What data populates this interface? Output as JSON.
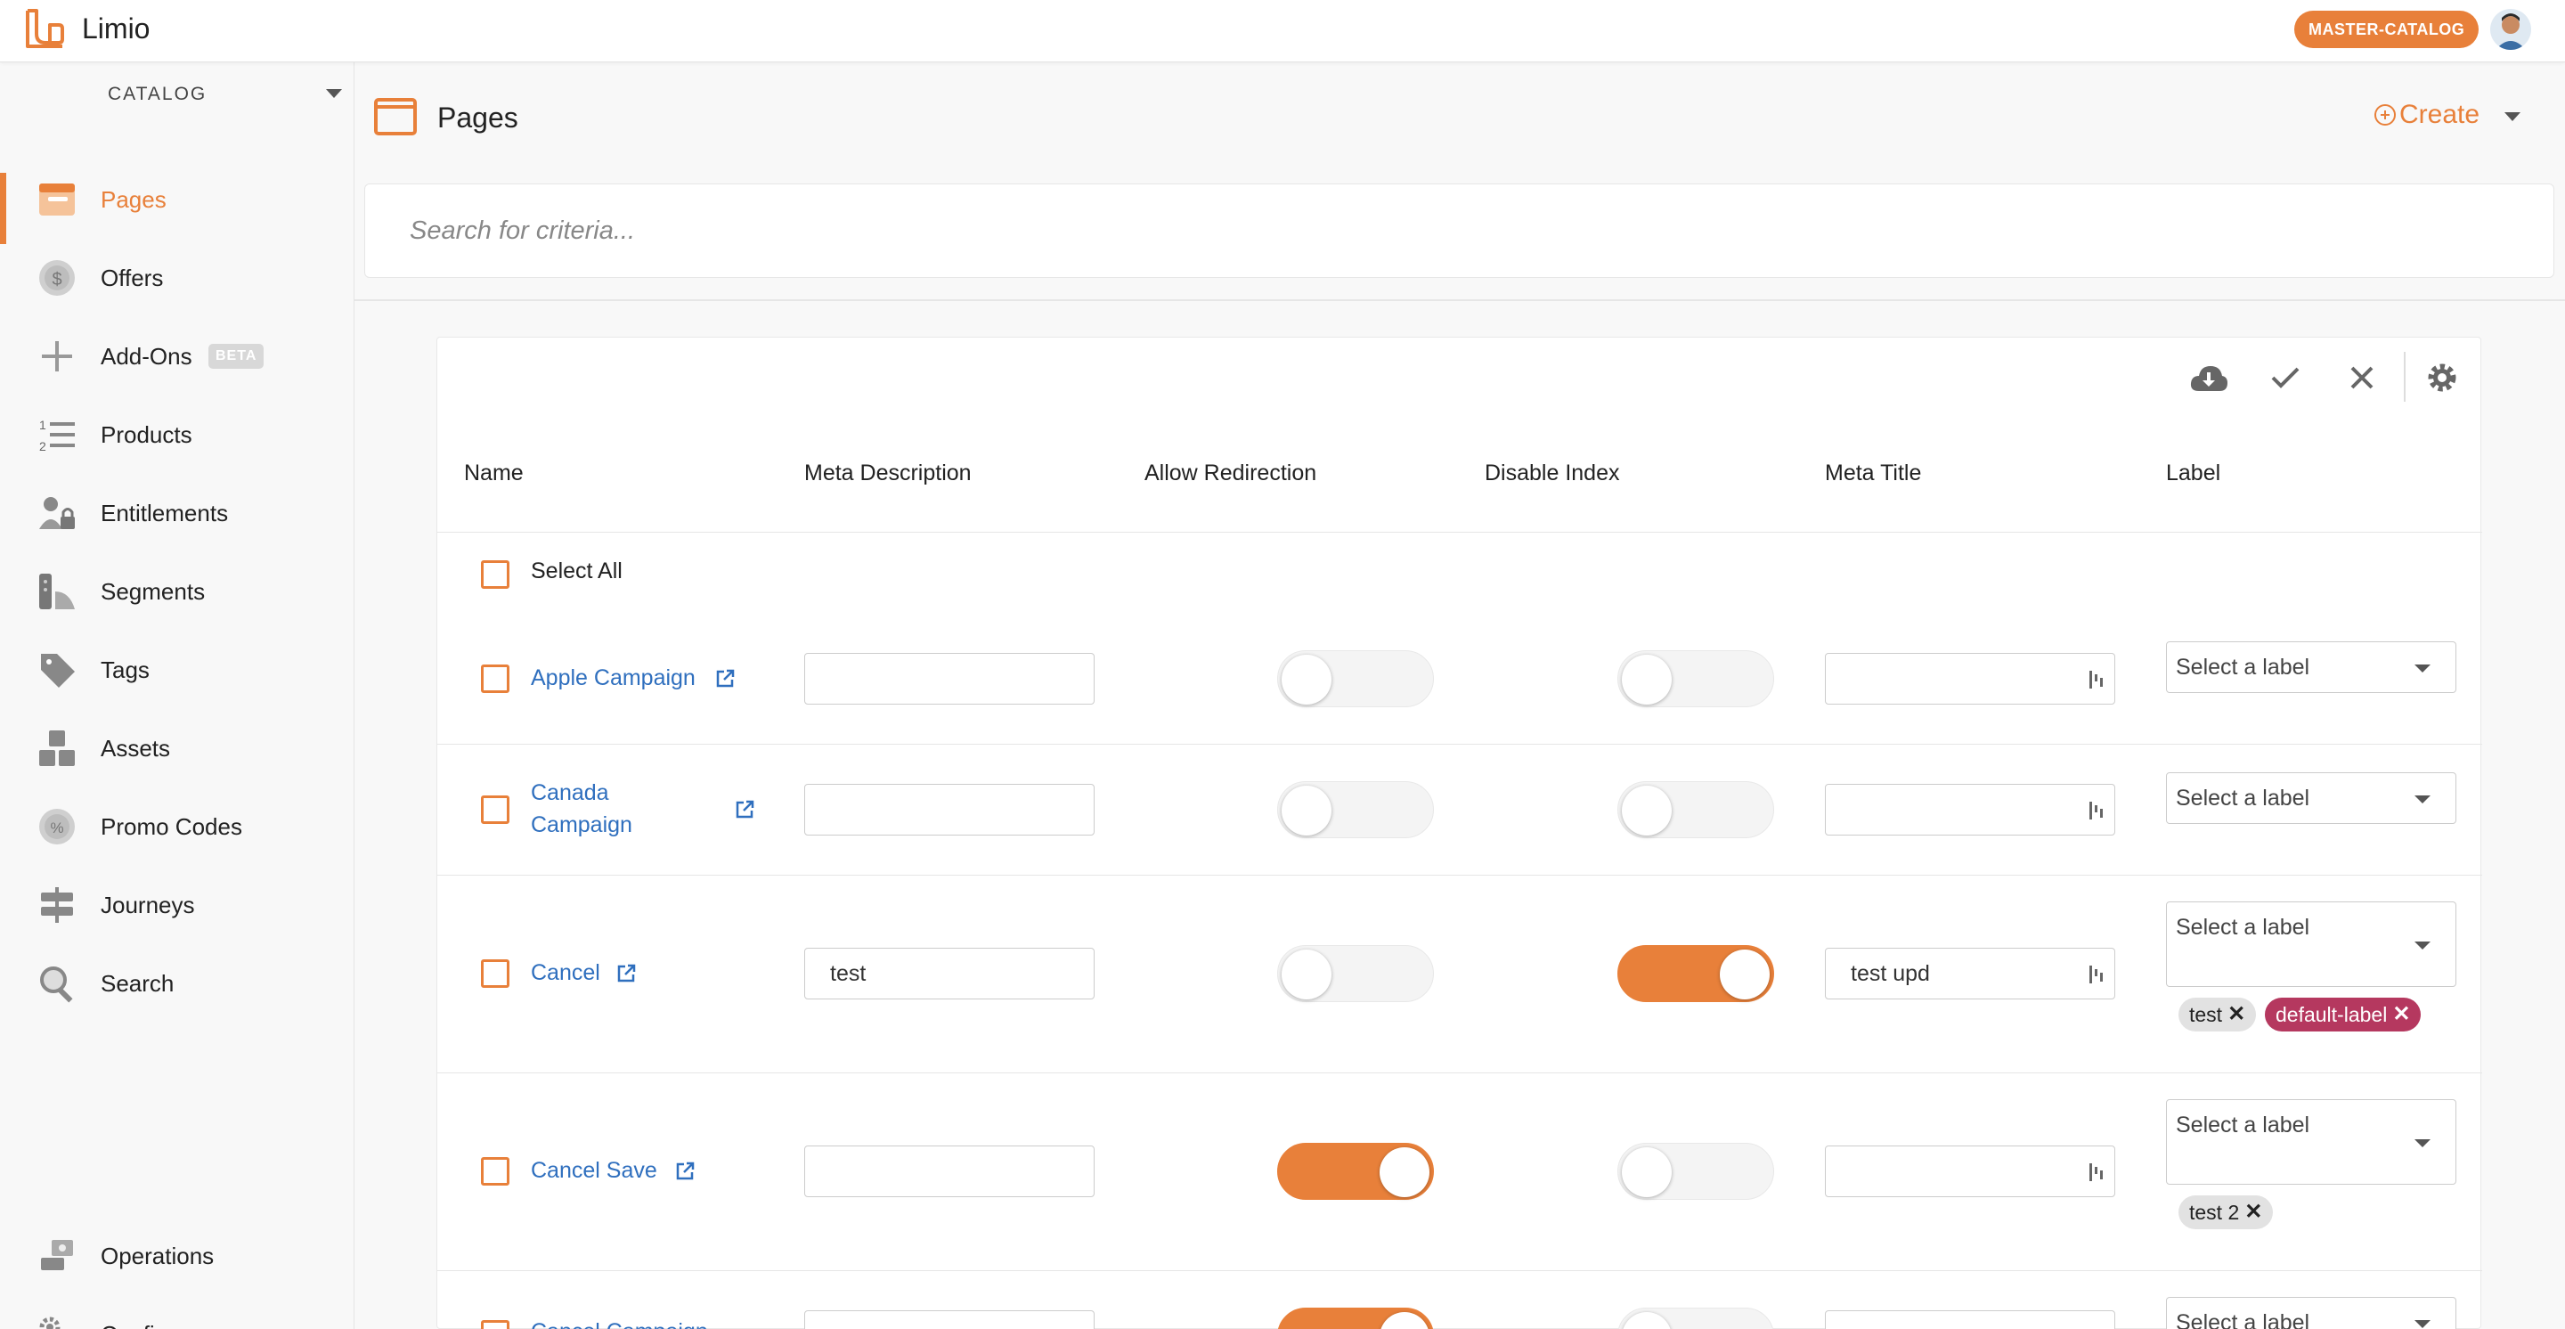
{
  "app": {
    "brand": "Limio",
    "catalog_badge": "MASTER-CATALOG"
  },
  "sidebar": {
    "catalog_label": "CATALOG",
    "items": [
      {
        "label": "Pages",
        "icon": "pages-icon",
        "active": true
      },
      {
        "label": "Offers",
        "icon": "offers-icon"
      },
      {
        "label": "Add-Ons",
        "icon": "plus-icon",
        "badge": "BETA"
      },
      {
        "label": "Products",
        "icon": "numbered-list-icon"
      },
      {
        "label": "Entitlements",
        "icon": "user-lock-icon"
      },
      {
        "label": "Segments",
        "icon": "segments-icon"
      },
      {
        "label": "Tags",
        "icon": "tags-icon"
      },
      {
        "label": "Assets",
        "icon": "boxes-icon"
      },
      {
        "label": "Promo Codes",
        "icon": "percent-badge-icon"
      },
      {
        "label": "Journeys",
        "icon": "signpost-icon"
      },
      {
        "label": "Search",
        "icon": "magnifier-icon"
      }
    ],
    "bottom_items": [
      {
        "label": "Operations",
        "icon": "operations-icon"
      },
      {
        "label": "Config",
        "icon": "gears-icon"
      }
    ]
  },
  "header": {
    "title": "Pages",
    "create_label": "Create"
  },
  "search": {
    "placeholder": "Search for criteria..."
  },
  "table": {
    "columns": [
      "Name",
      "Meta Description",
      "Allow Redirection",
      "Disable Index",
      "Meta Title",
      "Label"
    ],
    "select_all_label": "Select All",
    "label_placeholder": "Select a label",
    "rows": [
      {
        "name": "Apple Campaign",
        "meta_description": "",
        "allow_redirection": false,
        "disable_index": false,
        "meta_title": "",
        "labels": []
      },
      {
        "name_line1": "Canada",
        "name_line2": "Campaign",
        "meta_description": "",
        "allow_redirection": false,
        "disable_index": false,
        "meta_title": "",
        "labels": []
      },
      {
        "name": "Cancel",
        "meta_description": "test",
        "allow_redirection": false,
        "disable_index": true,
        "meta_title": "test upd",
        "labels": [
          "test",
          "default-label"
        ]
      },
      {
        "name": "Cancel Save",
        "meta_description": "",
        "allow_redirection": true,
        "disable_index": false,
        "meta_title": "",
        "labels": [
          "test 2"
        ]
      },
      {
        "name": "Cancel Campaign",
        "meta_description": "",
        "allow_redirection": true,
        "disable_index": false,
        "meta_title": "",
        "labels": []
      }
    ]
  },
  "colors": {
    "accent": "#e8803a",
    "link": "#2f6fbe",
    "pink_chip": "#b5385f"
  }
}
